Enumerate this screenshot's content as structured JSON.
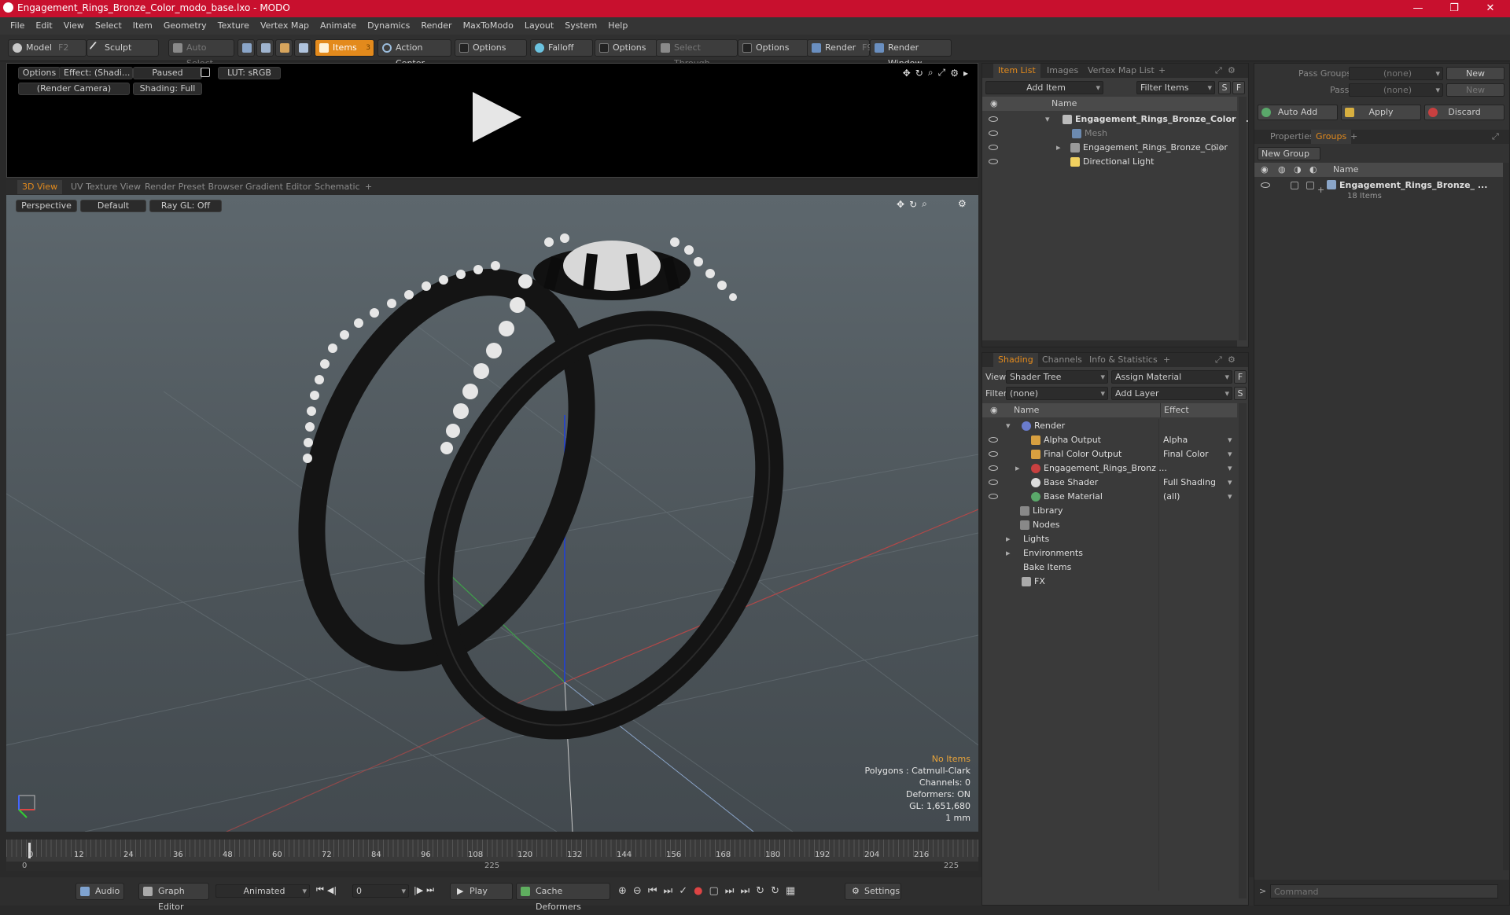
{
  "window": {
    "title": "Engagement_Rings_Bronze_Color_modo_base.lxo - MODO",
    "min": "—",
    "max": "❐",
    "close": "✕"
  },
  "menu": [
    "File",
    "Edit",
    "View",
    "Select",
    "Item",
    "Geometry",
    "Texture",
    "Vertex Map",
    "Animate",
    "Dynamics",
    "Render",
    "MaxToModo",
    "Layout",
    "System",
    "Help"
  ],
  "toolbar": {
    "model": "Model",
    "model_key": "F2",
    "sculpt": "Sculpt",
    "auto_select": "Auto Select",
    "items": "Items",
    "items_count": "3",
    "action_center": "Action Center",
    "options1": "Options",
    "falloff": "Falloff",
    "options2": "Options",
    "select_through": "Select Through",
    "options3": "Options",
    "render": "Render",
    "render_key": "F9",
    "render_window": "Render Window"
  },
  "render_preview": {
    "options": "Options",
    "effect": "Effect: (Shadi...",
    "paused": "Paused",
    "lut": "LUT: sRGB",
    "camera": "(Render Camera)",
    "shading": "Shading: Full"
  },
  "view_tabs": [
    "3D View",
    "UV Texture View",
    "Render Preset Browser",
    "Gradient Editor",
    "Schematic"
  ],
  "viewport": {
    "mode": "Perspective",
    "style": "Default",
    "raygl": "Ray GL: Off",
    "info": [
      "No Items",
      "Polygons : Catmull-Clark",
      "Channels: 0",
      "Deformers: ON",
      "GL: 1,651,680",
      "1 mm"
    ]
  },
  "timeline": {
    "ticks": [
      "0",
      "12",
      "24",
      "36",
      "48",
      "60",
      "72",
      "84",
      "96",
      "108",
      "120",
      "132",
      "144",
      "156",
      "168",
      "180",
      "192",
      "204",
      "216"
    ],
    "start": "0",
    "mid": "225",
    "end": "225"
  },
  "bottom": {
    "audio": "Audio",
    "graph_editor": "Graph Editor",
    "animated": "Animated",
    "frame": "0",
    "play": "Play",
    "cache": "Cache Deformers",
    "settings": "Settings"
  },
  "item_list": {
    "tabs": [
      "Item List",
      "Images",
      "Vertex Map List"
    ],
    "add_item": "Add Item",
    "filter": "Filter Items",
    "s": "S",
    "f": "F",
    "col_name": "Name",
    "rows": [
      {
        "label": "Engagement_Rings_Bronze_Color ...",
        "bold": true
      },
      {
        "label": "Mesh",
        "dim": true
      },
      {
        "label": "Engagement_Rings_Bronze_Color",
        "count": "(2)"
      },
      {
        "label": "Directional Light"
      }
    ]
  },
  "shading": {
    "tabs": [
      "Shading",
      "Channels",
      "Info & Statistics"
    ],
    "view_label": "View",
    "view_value": "Shader Tree",
    "assign": "Assign Material",
    "f": "F",
    "filter_label": "Filter",
    "filter_value": "(none)",
    "add_layer": "Add Layer",
    "s": "S",
    "col_name": "Name",
    "col_effect": "Effect",
    "rows": [
      {
        "label": "Render",
        "effect": ""
      },
      {
        "label": "Alpha Output",
        "effect": "Alpha"
      },
      {
        "label": "Final Color Output",
        "effect": "Final Color"
      },
      {
        "label": "Engagement_Rings_Bronz ...",
        "effect": ""
      },
      {
        "label": "Base Shader",
        "effect": "Full Shading"
      },
      {
        "label": "Base Material",
        "effect": "(all)"
      },
      {
        "label": "Library",
        "effect": ""
      },
      {
        "label": "Nodes",
        "effect": ""
      },
      {
        "label": "Lights",
        "effect": ""
      },
      {
        "label": "Environments",
        "effect": ""
      },
      {
        "label": "Bake Items",
        "effect": ""
      },
      {
        "label": "FX",
        "effect": ""
      }
    ]
  },
  "groups": {
    "pass_groups_label": "Pass Groups",
    "pass_groups_value": "(none)",
    "new": "New",
    "passes_label": "Passes",
    "passes_value": "(none)",
    "new2": "New",
    "auto_add": "Auto Add",
    "apply": "Apply",
    "discard": "Discard",
    "tabs": [
      "Properties",
      "Groups"
    ],
    "new_group": "New Group",
    "col_name": "Name",
    "item": "Engagement_Rings_Bronze_ ...",
    "item_count": "18 Items"
  },
  "command": {
    "placeholder": "Command"
  }
}
